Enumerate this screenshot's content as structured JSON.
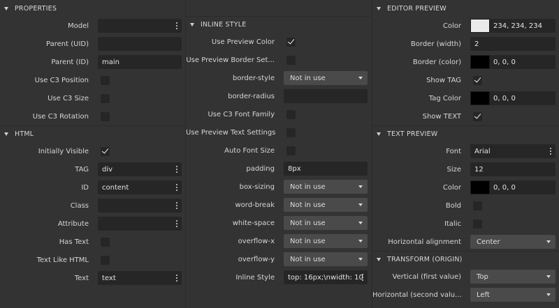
{
  "colors": {
    "panel_bg": "#333333",
    "field_bg": "#262626",
    "select_bg": "#4a4a4a",
    "preview_color": "#eaeaea",
    "border_color": "#000000",
    "tag_color": "#000000",
    "font_color": "#000000"
  },
  "properties": {
    "title": "PROPERTIES",
    "model_label": "Model",
    "model_value": "",
    "parent_uid_label": "Parent (UID)",
    "parent_uid_value": "",
    "parent_id_label": "Parent (ID)",
    "parent_id_value": "main",
    "use_c3_position_label": "Use C3 Position",
    "use_c3_size_label": "Use C3 Size",
    "use_c3_rotation_label": "Use C3 Rotation"
  },
  "html": {
    "title": "HTML",
    "initially_visible_label": "Initially Visible",
    "initially_visible": true,
    "tag_label": "TAG",
    "tag_value": "div",
    "id_label": "ID",
    "id_value": "content",
    "class_label": "Class",
    "class_value": "",
    "attribute_label": "Attribute",
    "attribute_value": "",
    "has_text_label": "Has Text",
    "text_like_html_label": "Text Like HTML",
    "text_label": "Text",
    "text_value": "text"
  },
  "inline_style": {
    "title": "INLINE STYLE",
    "use_preview_color_label": "Use Preview Color",
    "use_preview_color": true,
    "use_preview_border_label": "Use Preview Border Set...",
    "border_style_label": "border-style",
    "border_style_value": "Not in use",
    "border_radius_label": "border-radius",
    "border_radius_value": "",
    "use_c3_font_family_label": "Use C3 Font Family",
    "use_preview_text_label": "Use Preview Text Settings",
    "auto_font_size_label": "Auto Font Size",
    "padding_label": "padding",
    "padding_value": "8px",
    "box_sizing_label": "box-sizing",
    "box_sizing_value": "Not in use",
    "word_break_label": "word-break",
    "word_break_value": "Not in use",
    "white_space_label": "white-space",
    "white_space_value": "Not in use",
    "overflow_x_label": "overflow-x",
    "overflow_x_value": "Not in use",
    "overflow_y_label": "overflow-y",
    "overflow_y_value": "Not in use",
    "inline_style_label": "Inline Style",
    "inline_style_value": "top: 16px;\\nwidth: 10"
  },
  "editor_preview": {
    "title": "EDITOR PREVIEW",
    "color_label": "Color",
    "color_value": "234, 234, 234",
    "border_width_label": "Border (width)",
    "border_width_value": "2",
    "border_color_label": "Border (color)",
    "border_color_value": "0, 0, 0",
    "show_tag_label": "Show TAG",
    "show_tag": true,
    "tag_color_label": "Tag Color",
    "tag_color_value": "0, 0, 0",
    "show_text_label": "Show TEXT",
    "show_text": true
  },
  "text_preview": {
    "title": "TEXT PREVIEW",
    "font_label": "Font",
    "font_value": "Arial",
    "size_label": "Size",
    "size_value": "12",
    "color_label": "Color",
    "color_value": "0, 0, 0",
    "bold_label": "Bold",
    "italic_label": "Italic",
    "h_align_label": "Horizontal alignment",
    "h_align_value": "Center"
  },
  "transform": {
    "title": "TRANSFORM (ORIGIN)",
    "vertical_label": "Vertical (first value)",
    "vertical_value": "Top",
    "horizontal_label": "Horizontal (second valu...",
    "horizontal_value": "Left"
  }
}
